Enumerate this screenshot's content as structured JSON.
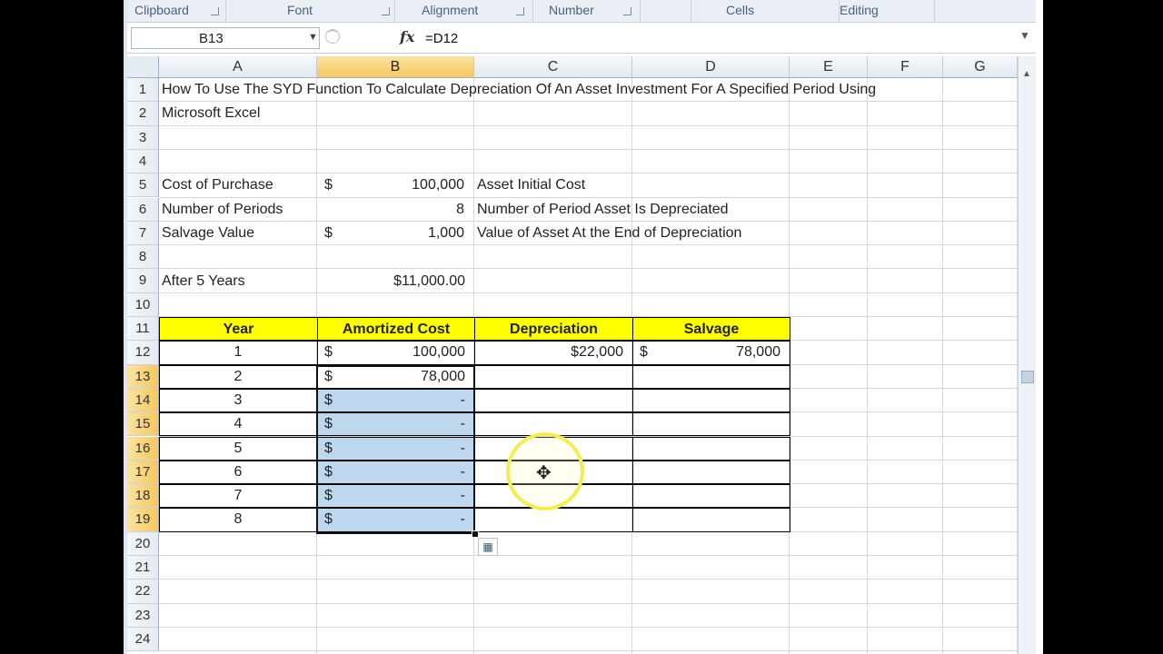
{
  "ribbon": {
    "groups": [
      {
        "label": "Clipboard"
      },
      {
        "label": "Font"
      },
      {
        "label": "Alignment"
      },
      {
        "label": "Number"
      },
      {
        "label": "Cells"
      },
      {
        "label": "Editing"
      }
    ]
  },
  "formula_bar": {
    "name_box": "B13",
    "formula": "=D12",
    "fx_label": "fx"
  },
  "columns": [
    "A",
    "B",
    "C",
    "D",
    "E",
    "F",
    "G"
  ],
  "rows": [
    "1",
    "2",
    "3",
    "4",
    "5",
    "6",
    "7",
    "8",
    "9",
    "10",
    "11",
    "12",
    "13",
    "14",
    "15",
    "16",
    "17",
    "18",
    "19",
    "20",
    "21",
    "22",
    "23",
    "24"
  ],
  "selected_column": "B",
  "selected_rows": [
    "13",
    "14",
    "15",
    "16",
    "17",
    "18",
    "19"
  ],
  "sheet": {
    "title_line1": "How To Use The SYD Function To Calculate Depreciation Of An Asset Investment For  A Specified Period Using",
    "title_line2": "Microsoft Excel",
    "inputs": [
      {
        "label": "Cost of Purchase",
        "currency": "$",
        "value": "100,000",
        "note": "Asset Initial Cost"
      },
      {
        "label": "Number of Periods",
        "currency": "",
        "value": "8",
        "note": "Number of Period Asset Is Depreciated"
      },
      {
        "label": "Salvage Value",
        "currency": "$",
        "value": "1,000",
        "note": "Value of Asset At the End of Depreciation"
      }
    ],
    "after_label": "After 5 Years",
    "after_value": "$11,000.00",
    "table": {
      "headers": [
        "Year",
        "Amortized Cost",
        "Depreciation",
        "Salvage"
      ],
      "rows": [
        {
          "year": "1",
          "cost_cur": "$",
          "cost": "100,000",
          "dep": "$22,000",
          "salv_cur": "$",
          "salv": "78,000"
        },
        {
          "year": "2",
          "cost_cur": "$",
          "cost": "78,000",
          "dep": "",
          "salv_cur": "",
          "salv": ""
        },
        {
          "year": "3",
          "cost_cur": "$",
          "cost": "-",
          "dep": "",
          "salv_cur": "",
          "salv": ""
        },
        {
          "year": "4",
          "cost_cur": "$",
          "cost": "-",
          "dep": "",
          "salv_cur": "",
          "salv": ""
        },
        {
          "year": "5",
          "cost_cur": "$",
          "cost": "-",
          "dep": "",
          "salv_cur": "",
          "salv": ""
        },
        {
          "year": "6",
          "cost_cur": "$",
          "cost": "-",
          "dep": "",
          "salv_cur": "",
          "salv": ""
        },
        {
          "year": "7",
          "cost_cur": "$",
          "cost": "-",
          "dep": "",
          "salv_cur": "",
          "salv": ""
        },
        {
          "year": "8",
          "cost_cur": "$",
          "cost": "-",
          "dep": "",
          "salv_cur": "",
          "salv": ""
        }
      ]
    }
  },
  "colors": {
    "header_fill": "#ffff00",
    "selection_fill": "#bdd7ee",
    "selected_header": "#f6c75c"
  }
}
